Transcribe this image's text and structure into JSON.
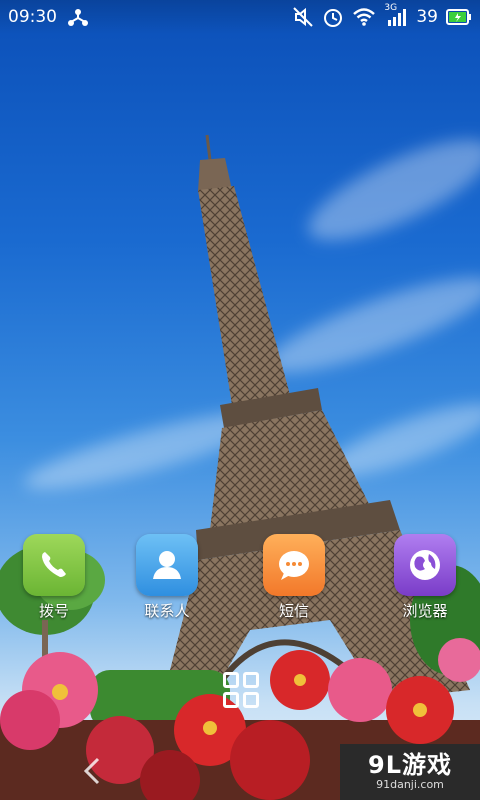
{
  "status_bar": {
    "time": "09:30",
    "battery_level": "39",
    "signal_label": "3G",
    "icons": [
      "usb-share-icon",
      "mute-icon",
      "alarm-icon",
      "wifi-icon",
      "signal-icon",
      "battery-icon"
    ]
  },
  "dock": {
    "apps": [
      {
        "label": "拨号",
        "icon": "phone-icon",
        "color": "#7cc242"
      },
      {
        "label": "联系人",
        "icon": "contact-icon",
        "color": "#3aa2e8"
      },
      {
        "label": "短信",
        "icon": "message-icon",
        "color": "#f58a35"
      },
      {
        "label": "浏览器",
        "icon": "browser-globe-icon",
        "color": "#8a4fd6"
      }
    ]
  },
  "watermark": {
    "main": "9L游戏",
    "sub": "91danji.com"
  },
  "colors": {
    "sky_top": "#0b4fb8",
    "tower": "#6b5a4a",
    "battery_green": "#3ccf3c"
  }
}
